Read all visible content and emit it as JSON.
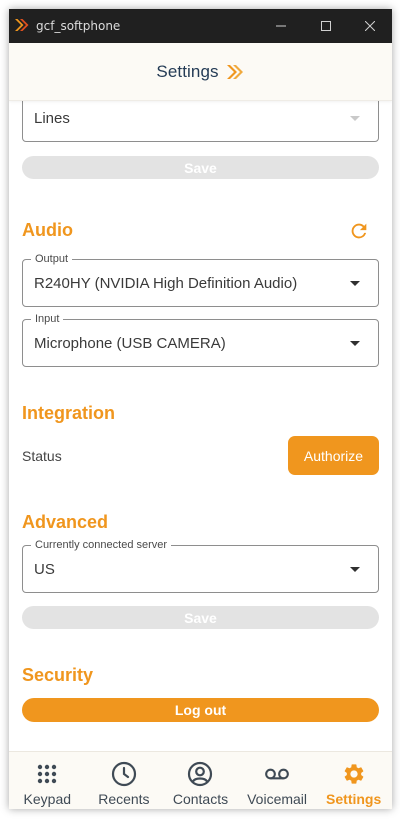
{
  "window": {
    "title": "gcf_softphone"
  },
  "header": {
    "title": "Settings"
  },
  "lines": {
    "value": "Lines",
    "save_label": "Save"
  },
  "audio": {
    "title": "Audio",
    "output": {
      "label": "Output",
      "value": "R240HY (NVIDIA High Definition Audio)"
    },
    "input": {
      "label": "Input",
      "value": "Microphone (USB CAMERA)"
    }
  },
  "integration": {
    "title": "Integration",
    "status_label": "Status",
    "authorize_label": "Authorize"
  },
  "advanced": {
    "title": "Advanced",
    "server": {
      "label": "Currently connected server",
      "value": "US"
    },
    "save_label": "Save"
  },
  "security": {
    "title": "Security",
    "logout_label": "Log out"
  },
  "nav": {
    "items": [
      {
        "label": "Keypad",
        "icon": "keypad-icon",
        "active": false
      },
      {
        "label": "Recents",
        "icon": "clock-icon",
        "active": false
      },
      {
        "label": "Contacts",
        "icon": "contact-icon",
        "active": false
      },
      {
        "label": "Voicemail",
        "icon": "voicemail-icon",
        "active": false
      },
      {
        "label": "Settings",
        "icon": "gear-icon",
        "active": true
      }
    ]
  },
  "colors": {
    "accent": "#f0961e",
    "title_text": "#243b55",
    "titlebar": "#202020",
    "disabled": "#e3e3e3"
  }
}
